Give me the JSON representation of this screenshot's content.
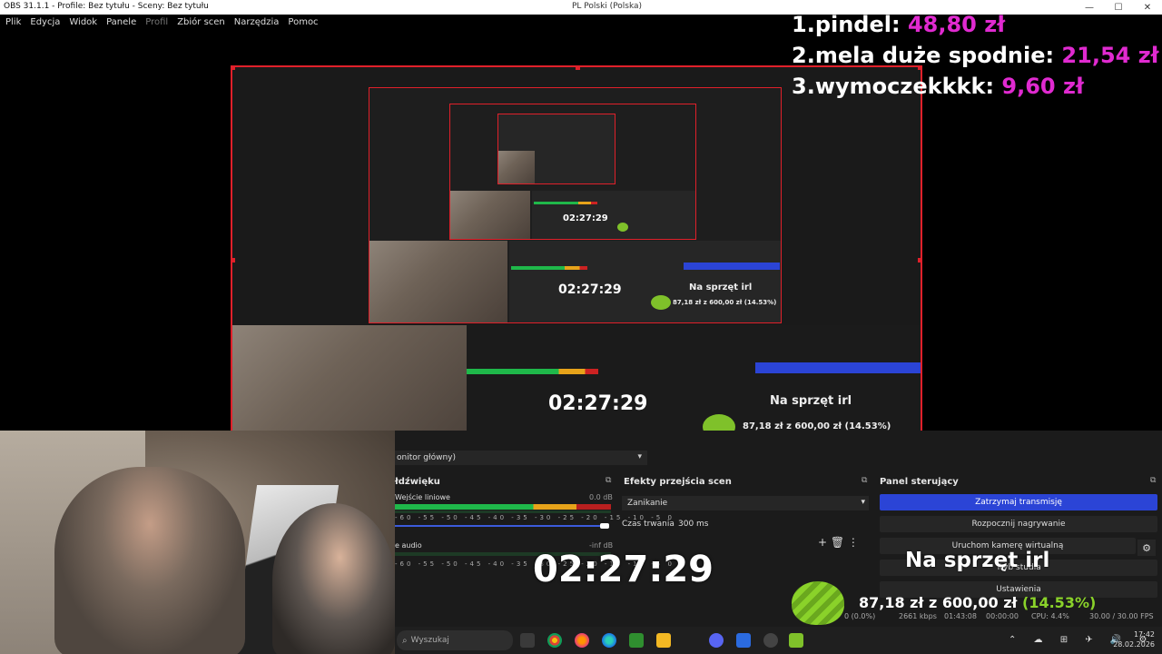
{
  "window": {
    "title": "OBS 31.1.1 - Profile: Bez tytułu - Sceny: Bez tytułu",
    "keyboard_layout": "PL Polski (Polska)",
    "minimize": "—",
    "maximize": "☐",
    "close": "✕"
  },
  "menu": {
    "items": [
      "Plik",
      "Edycja",
      "Widok",
      "Panele",
      "Profil",
      "Zbiór scen",
      "Narzędzia",
      "Pomoc"
    ]
  },
  "leaderboard": {
    "rows": [
      {
        "name": "1.pindel: ",
        "amount": "48,80 zł"
      },
      {
        "name": "2.mela duże spodnie: ",
        "amount": "21,54 zł"
      },
      {
        "name": "3.wymoczekkkk: ",
        "amount": "9,60 zł"
      }
    ]
  },
  "scene_bar": {
    "scene_text": "onitor główny)",
    "chevron": "▾"
  },
  "mixer": {
    "header": "łdźwięku",
    "channel1_label": "Wejście liniowe",
    "channel1_db": "0.0 dB",
    "channel2_label": "e audio",
    "channel2_db": "-inf dB",
    "scale": "-60 -55 -50 -45 -40 -35 -30 -25 -20 -15 -10 -5 0"
  },
  "transitions": {
    "header": "Efekty przejścia scen",
    "selected": "Zanikanie",
    "duration_label": "Czas trwania",
    "duration_value": "300 ms",
    "icons": "+  🗑  ⋮"
  },
  "controls": {
    "header": "Panel sterujący",
    "stop_stream": "Zatrzymaj transmisję",
    "start_recording": "Rozpocznij nagrywanie",
    "start_virtual_cam": "Uruchom kamerę wirtualną",
    "studio_mode": "Tryb studia",
    "settings": "Ustawienia",
    "gear": "⚙"
  },
  "overlay": {
    "timer": "02:27:29",
    "hardware_goal": "Na sprzęt irl",
    "donation_current": "87,18 zł",
    "donation_sep": " z ",
    "donation_target": "600,00 zł",
    "donation_pct": " (14.53%)"
  },
  "status": {
    "dropped": "0 (0.0%)",
    "bitrate": "2661 kbps",
    "time": "01:43:08",
    "rec": "00:00:00",
    "cpu": "CPU: 4.4%",
    "fps": "30.00 / 30.00 FPS"
  },
  "taskbar": {
    "search_placeholder": "Wyszukaj",
    "tray": "⌃ ☁ ⊞ ✈ 🔊 ⚙",
    "time": "17:42",
    "date": "28.02.2026"
  },
  "nested": {
    "timer": "02:27:29",
    "label": "Na sprzęt irl",
    "donation": "87,18 zł z 600,00 zł (14.53%)"
  },
  "colors": {
    "accent_blue": "#2b44d6",
    "selection_red": "#e0202a",
    "leader_amount": "#e02ad0",
    "progress_green": "#8ad22a"
  }
}
